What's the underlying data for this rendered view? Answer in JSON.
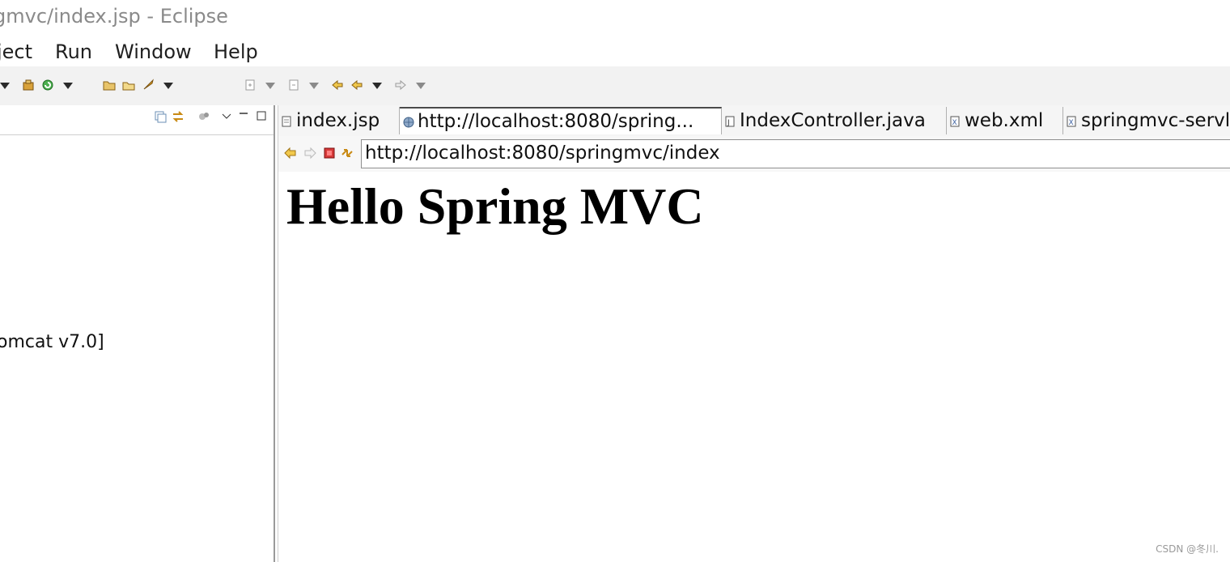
{
  "window": {
    "title": "gmvc/index.jsp - Eclipse"
  },
  "menubar": {
    "items": [
      "ject",
      "Run",
      "Window",
      "Help"
    ]
  },
  "toolbar": {
    "icons": [
      "dropdown-caret",
      "package-icon",
      "refresh-run-icon",
      "dropdown-caret",
      "open-folder-icon",
      "open-file-icon",
      "launch-icon",
      "dropdown-caret",
      "next-annotation-icon",
      "dropdown-caret",
      "prev-annotation-icon",
      "dropdown-caret",
      "last-edit-icon",
      "back-icon",
      "dropdown-caret",
      "forward-icon",
      "dropdown-caret"
    ]
  },
  "left_panel": {
    "partial_text": "omcat v7.0]"
  },
  "editor": {
    "tabs": [
      {
        "label": "index.jsp",
        "icon": "jsp-file-icon"
      },
      {
        "label": "http://localhost:8080/spring...",
        "icon": "globe-icon"
      },
      {
        "label": "IndexController.java",
        "icon": "java-file-icon"
      },
      {
        "label": "web.xml",
        "icon": "xml-file-icon"
      },
      {
        "label": "springmvc-servle",
        "icon": "xml-file-icon"
      }
    ],
    "active_tab": 1
  },
  "browser": {
    "url": "http://localhost:8080/springmvc/index",
    "heading": "Hello Spring MVC"
  },
  "watermark": "CSDN @冬川."
}
